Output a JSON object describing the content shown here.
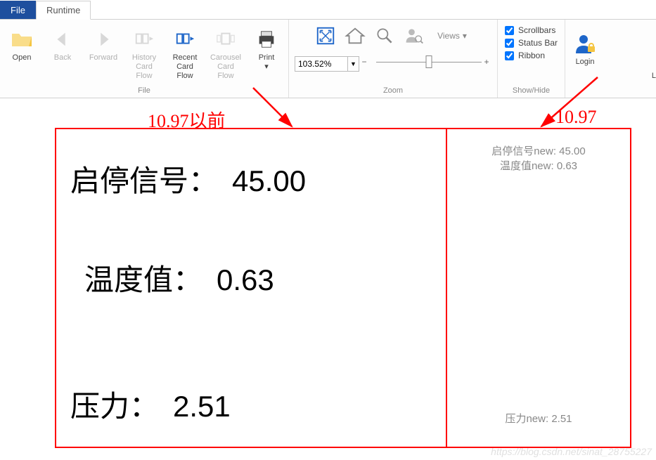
{
  "tabs": {
    "file": "File",
    "runtime": "Runtime"
  },
  "ribbon": {
    "file_group_label": "File",
    "open": "Open",
    "back": "Back",
    "forward": "Forward",
    "history": "History\nCard Flow",
    "recent": "Recent\nCard Flow",
    "carousel": "Carousel\nCard Flow",
    "print": "Print",
    "zoom_group_label": "Zoom",
    "zoom_value": "103.52%",
    "views": "Views",
    "showhide_label": "Show/Hide",
    "scrollbars": "Scrollbars",
    "statusbar": "Status Bar",
    "ribbon_chk": "Ribbon",
    "login": "Login",
    "login_cut": "L"
  },
  "annotations": {
    "left": "10.97以前",
    "right": "10.97"
  },
  "data_rows": {
    "row1_label": "启停信号：",
    "row1_value": "45.00",
    "row2_label": "温度值：",
    "row2_value": "0.63",
    "row3_label": "压力：",
    "row3_value": "2.51",
    "small1": "启停信号new: 45.00",
    "small2": "温度值new: 0.63",
    "small3": "压力new: 2.51"
  },
  "watermark": "https://blog.csdn.net/sinat_28755227"
}
